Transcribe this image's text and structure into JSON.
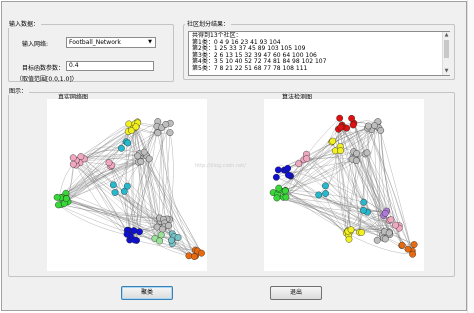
{
  "input_panel": {
    "title": "输入数据：",
    "network_label": "输入网络:",
    "network_value": "Football_Network",
    "param_label": "目标函数参数：",
    "param_value": "0.4",
    "param_range": "（取值范围[0.0,1.0]）"
  },
  "result_panel": {
    "title": "社区划分结果：",
    "lines": [
      "共得到13个社区：",
      "第1类：0 4 9 16 23 41 93 104",
      "第2类：1 25 33 37 45 89 103 105 109",
      "第3类：2 6 13 15 32 39 47 60 64 100 106",
      "第4类：3 5 10 40 52 72 74 81 84 98 102 107",
      "第5类：7 8 21 22 51 68 77 78 108 111"
    ]
  },
  "figure": {
    "title": "图示：",
    "left_title": "真实网络图",
    "right_title": "算法检测图",
    "watermark": "http://blog.csdn.net/"
  },
  "buttons": {
    "cluster": "聚类",
    "exit": "退出"
  },
  "colors": {
    "yellow": "#f2f01e",
    "red": "#e01010",
    "gray": "#bdbdbd",
    "cyan": "#26b8cc",
    "pink": "#f0a8c0",
    "green": "#38d838",
    "blue": "#1010d0",
    "orange": "#e86a10",
    "purple": "#b07ad8",
    "teal": "#76c2c6",
    "lime": "#9ae29a"
  }
}
